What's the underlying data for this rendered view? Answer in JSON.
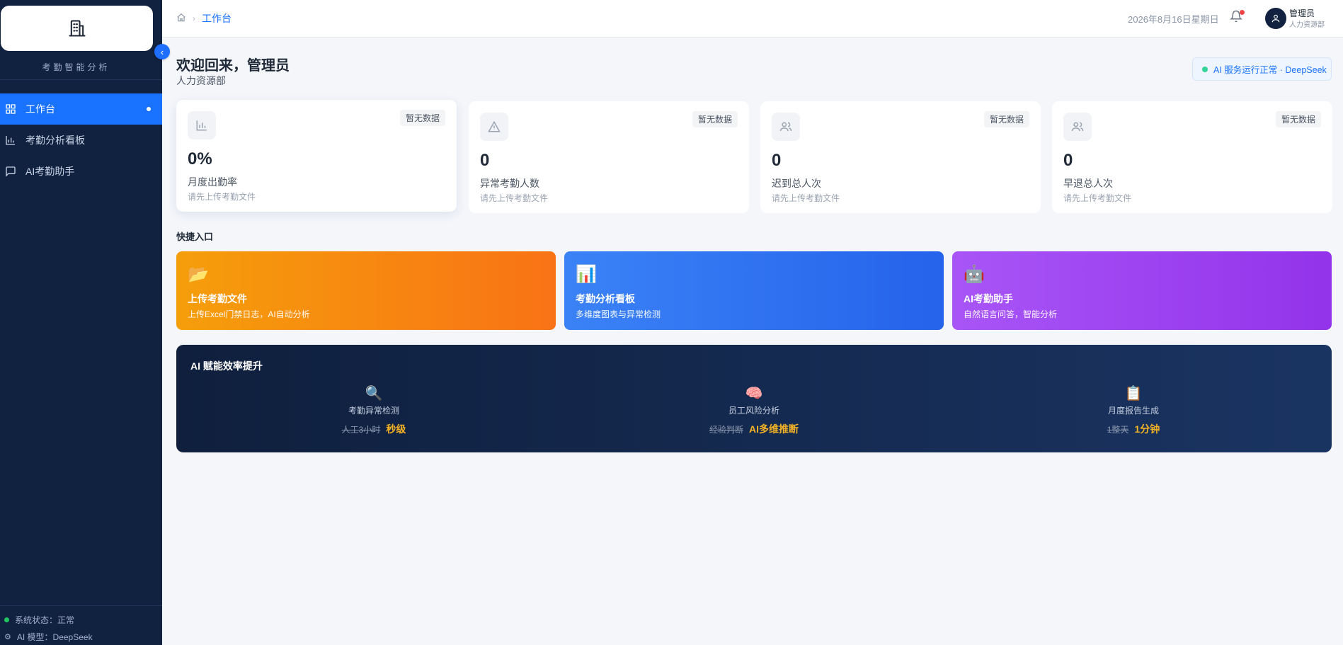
{
  "sidebar": {
    "logo_subtitle": "考勤智能分析",
    "items": [
      {
        "label": "工作台",
        "icon": "dashboard-icon",
        "active": true
      },
      {
        "label": "考勤分析看板",
        "icon": "bar-chart-icon",
        "active": false
      },
      {
        "label": "AI考勤助手",
        "icon": "chat-icon",
        "active": false
      }
    ],
    "status": "系统状态：正常",
    "model": "AI 模型：DeepSeek"
  },
  "header": {
    "breadcrumb_current": "工作台",
    "date": "2026年8月16日星期日",
    "user_name": "管理员",
    "user_dept": "人力资源部"
  },
  "main": {
    "welcome": "欢迎回来，管理员",
    "dept": "人力资源部",
    "ai_status": "AI 服务运行正常 · DeepSeek",
    "stats": [
      {
        "value": "0%",
        "label": "月度出勤率",
        "hint": "请先上传考勤文件",
        "tag": "暂无数据",
        "icon": "bar-chart-icon"
      },
      {
        "value": "0",
        "label": "异常考勤人数",
        "hint": "请先上传考勤文件",
        "tag": "暂无数据",
        "icon": "warning-icon"
      },
      {
        "value": "0",
        "label": "迟到总人次",
        "hint": "请先上传考勤文件",
        "tag": "暂无数据",
        "icon": "users-icon"
      },
      {
        "value": "0",
        "label": "早退总人次",
        "hint": "请先上传考勤文件",
        "tag": "暂无数据",
        "icon": "users-icon"
      }
    ],
    "quick_title": "快捷入口",
    "quick": [
      {
        "emoji": "📂",
        "title": "上传考勤文件",
        "desc": "上传Excel门禁日志，AI自动分析"
      },
      {
        "emoji": "📊",
        "title": "考勤分析看板",
        "desc": "多维度图表与异常检测"
      },
      {
        "emoji": "🤖",
        "title": "AI考勤助手",
        "desc": "自然语言问答，智能分析"
      }
    ],
    "ai_panel": {
      "title": "AI 赋能效率提升",
      "features": [
        {
          "emoji": "🔍",
          "name": "考勤异常检测",
          "old": "人工3小时",
          "new": "秒级"
        },
        {
          "emoji": "🧠",
          "name": "员工风险分析",
          "old": "经验判断",
          "new": "AI多维推断"
        },
        {
          "emoji": "📋",
          "name": "月度报告生成",
          "old": "1整天",
          "new": "1分钟"
        }
      ]
    }
  },
  "colors": {
    "accent": "#1a73ff",
    "sidebar": "#112240",
    "warning_text": "#f5b324"
  }
}
